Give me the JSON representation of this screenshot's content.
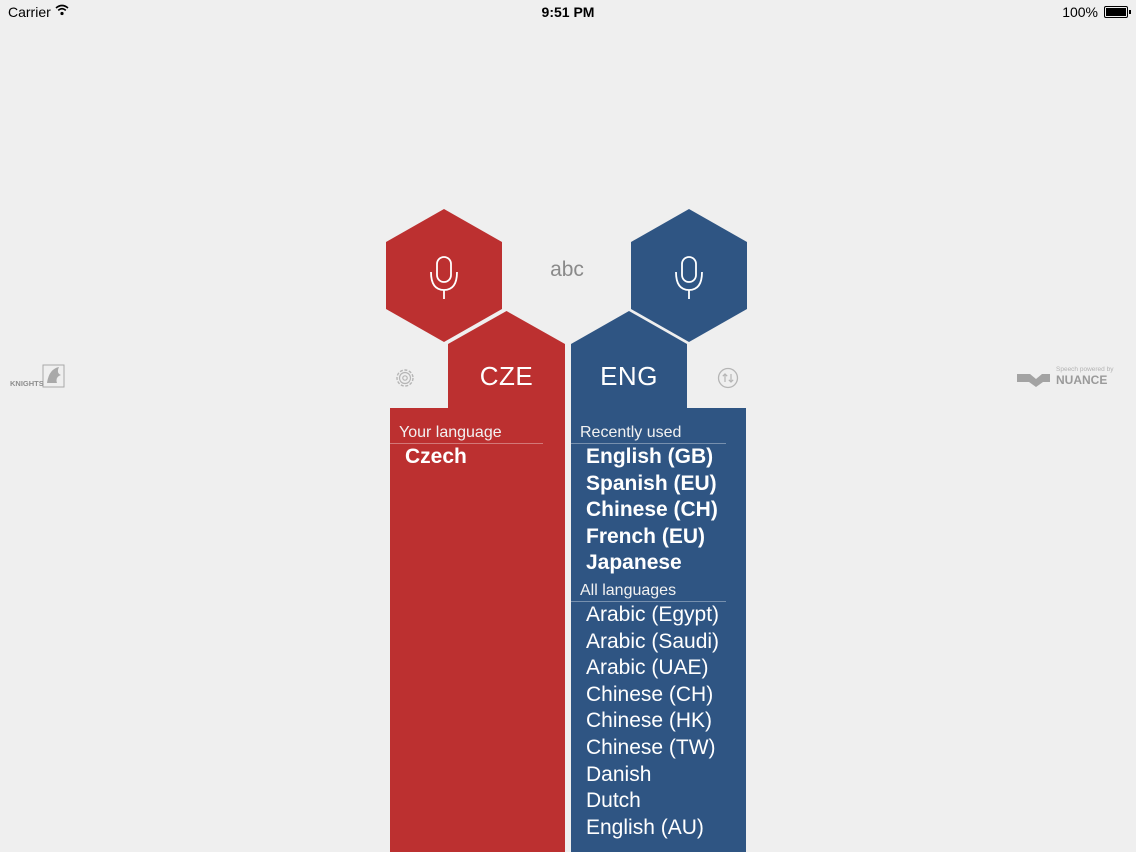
{
  "status_bar": {
    "carrier": "Carrier",
    "time": "9:51 PM",
    "battery": "100%"
  },
  "center": {
    "mode_label": "abc"
  },
  "source": {
    "code": "CZE",
    "color": "#bc3030",
    "header": "Your language",
    "languages": [
      "Czech"
    ]
  },
  "target": {
    "code": "ENG",
    "color": "#2f5583",
    "recent_header": "Recently used",
    "recent": [
      "English (GB)",
      "Spanish (EU)",
      "Chinese (CH)",
      "French (EU)",
      "Japanese"
    ],
    "all_header": "All languages",
    "all": [
      "Arabic (Egypt)",
      "Arabic (Saudi)",
      "Arabic (UAE)",
      "Chinese (CH)",
      "Chinese (HK)",
      "Chinese (TW)",
      "Danish",
      "Dutch",
      "English (AU)"
    ]
  },
  "icons": {
    "left_mic": "microphone-icon",
    "right_mic": "microphone-icon",
    "settings": "gear-icon",
    "swap": "swap-arrows-icon",
    "logo_left": "knights-logo-icon",
    "logo_right": "nuance-logo-icon"
  },
  "branding": {
    "left_logo_text": "KNIGHTS",
    "right_logo_caption": "Speech powered by",
    "right_logo_name": "NUANCE"
  }
}
